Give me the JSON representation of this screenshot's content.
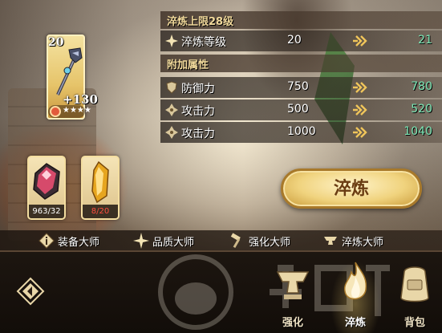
{
  "weapon": {
    "level": "20",
    "bonus": "+130",
    "stars": "★★★★"
  },
  "materials": [
    {
      "count": "963/32"
    },
    {
      "count": "8/20"
    }
  ],
  "refine_panel": {
    "title": "淬炼上限28级",
    "level_row": {
      "label": "淬炼等级",
      "old": "20",
      "new": "21"
    },
    "bonus_title": "附加属性",
    "stats": [
      {
        "label": "防御力",
        "old": "750",
        "new": "780",
        "icon": "shield-icon"
      },
      {
        "label": "攻击力",
        "old": "500",
        "new": "520",
        "icon": "attack-icon"
      },
      {
        "label": "攻击力",
        "old": "1000",
        "new": "1040",
        "icon": "attack-icon"
      }
    ]
  },
  "refine_button": {
    "label": "淬炼"
  },
  "masters": [
    {
      "label": "装备大师",
      "icon": "info-icon"
    },
    {
      "label": "品质大师",
      "icon": "sparkle-icon"
    },
    {
      "label": "强化大师",
      "icon": "hammer-icon"
    },
    {
      "label": "淬炼大师",
      "icon": "anvil-icon"
    }
  ],
  "bottom_nav": {
    "tabs": [
      {
        "label": "强化",
        "icon": "anvil-icon",
        "active": false
      },
      {
        "label": "淬炼",
        "icon": "flame-icon",
        "active": true
      },
      {
        "label": "背包",
        "icon": "backpack-icon",
        "active": false
      }
    ]
  },
  "colors": {
    "stat_increase": "#7be7b6",
    "insufficient": "#ff4d3f",
    "gold": "#f0d37e"
  }
}
